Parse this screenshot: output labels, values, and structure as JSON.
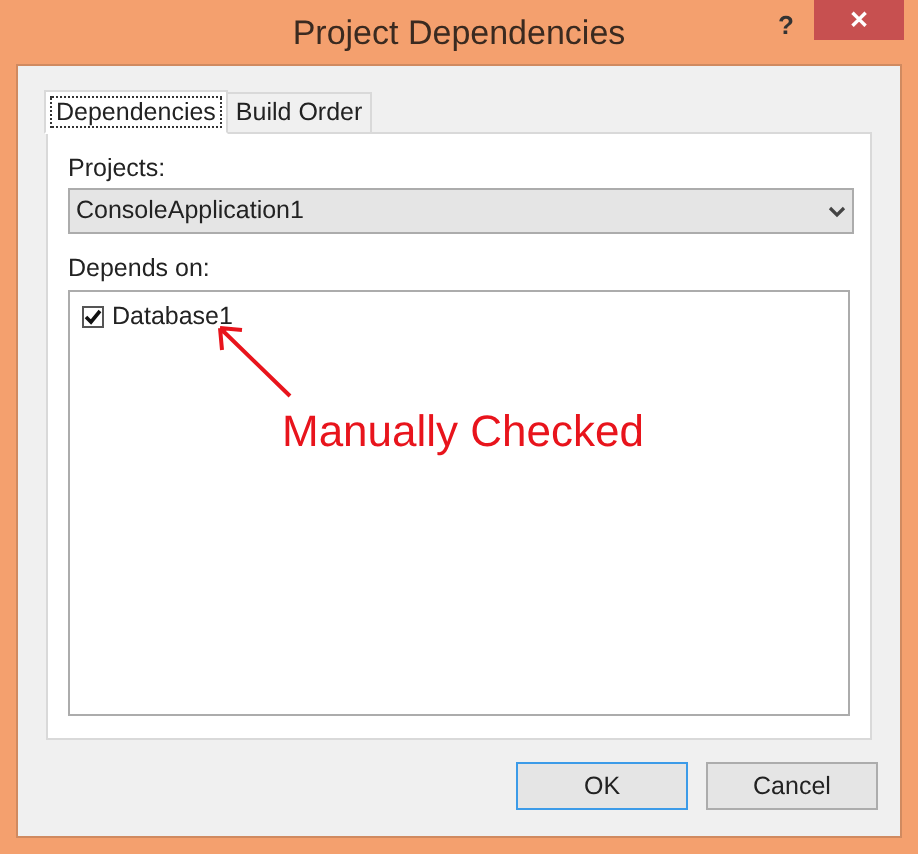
{
  "window": {
    "title": "Project Dependencies",
    "help": "?",
    "close": "✕"
  },
  "tabs": [
    {
      "label": "Dependencies",
      "selected": true
    },
    {
      "label": "Build Order",
      "selected": false
    }
  ],
  "projects": {
    "label": "Projects:",
    "value": "ConsoleApplication1"
  },
  "depends_on": {
    "label": "Depends on:",
    "items": [
      {
        "label": "Database1",
        "checked": true
      }
    ]
  },
  "annotation": {
    "text": "Manually Checked"
  },
  "buttons": [
    {
      "label": "OK",
      "default": true
    },
    {
      "label": "Cancel",
      "default": false
    }
  ]
}
